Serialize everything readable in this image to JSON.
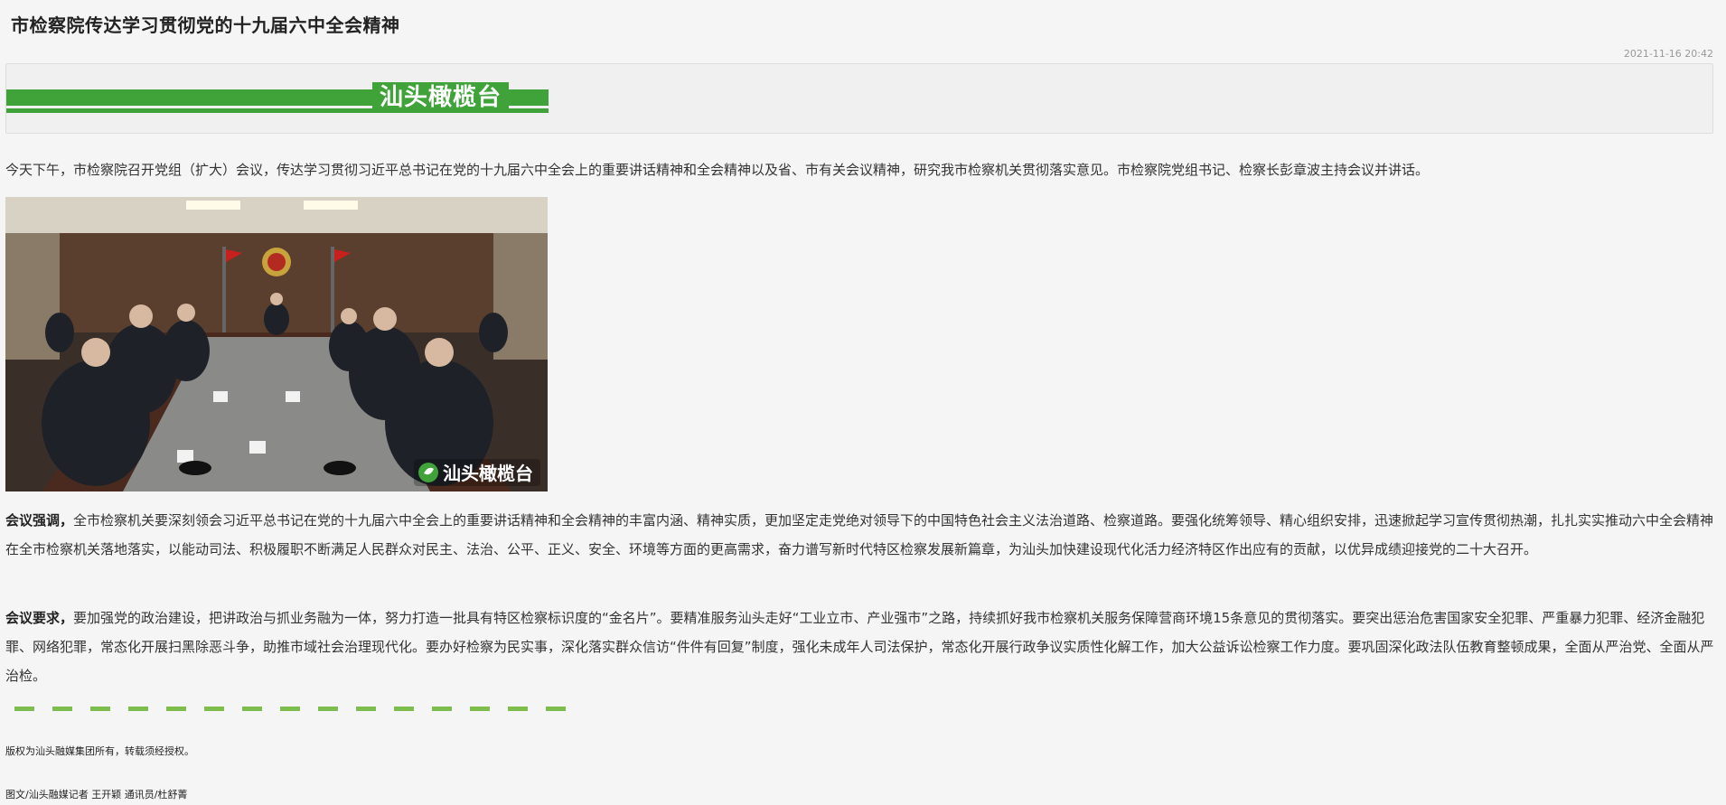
{
  "article": {
    "title": "市检察院传达学习贯彻党的十九届六中全会精神",
    "date": "2021-11-16 20:42",
    "banner_text": "汕头橄榄台",
    "paragraph1": "今天下午，市检察院召开党组（扩大）会议，传达学习贯彻习近平总书记在党的十九届六中全会上的重要讲话精神和全会精神以及省、市有关会议精神，研究我市检察机关贯彻落实意见。市检察院党组书记、检察长彭章波主持会议并讲话。",
    "paragraph2_lead": "会议强调，",
    "paragraph2": "全市检察机关要深刻领会习近平总书记在党的十九届六中全会上的重要讲话精神和全会精神的丰富内涵、精神实质，更加坚定走党绝对领导下的中国特色社会主义法治道路、检察道路。要强化统筹领导、精心组织安排，迅速掀起学习宣传贯彻热潮，扎扎实实推动六中全会精神在全市检察机关落地落实，以能动司法、积极履职不断满足人民群众对民主、法治、公平、正义、安全、环境等方面的更高需求，奋力谱写新时代特区检察发展新篇章，为汕头加快建设现代化活力经济特区作出应有的贡献，以优异成绩迎接党的二十大召开。",
    "paragraph3_lead": "会议要求，",
    "paragraph3": "要加强党的政治建设，把讲政治与抓业务融为一体，努力打造一批具有特区检察标识度的“金名片”。要精准服务汕头走好“工业立市、产业强市”之路，持续抓好我市检察机关服务保障营商环境15条意见的贯彻落实。要突出惩治危害国家安全犯罪、严重暴力犯罪、经济金融犯罪、网络犯罪，常态化开展扫黑除恶斗争，助推市域社会治理现代化。要办好检察为民实事，深化落实群众信访“件件有回复”制度，强化未成年人司法保护，常态化开展行政争议实质性化解工作，加大公益诉讼检察工作力度。要巩固深化政法队伍教育整顿成果，全面从严治党、全面从严治检。",
    "photo_watermark": "汕头橄榄台",
    "copyright": "版权为汕头融媒集团所有，转载须经授权。",
    "credit": "图文/汕头融媒记者 王开颖 通讯员/杜舒菁"
  },
  "colors": {
    "accent_green": "#3fa33a",
    "dash_green": "#7cbd4e",
    "background": "#f5f5f5"
  }
}
